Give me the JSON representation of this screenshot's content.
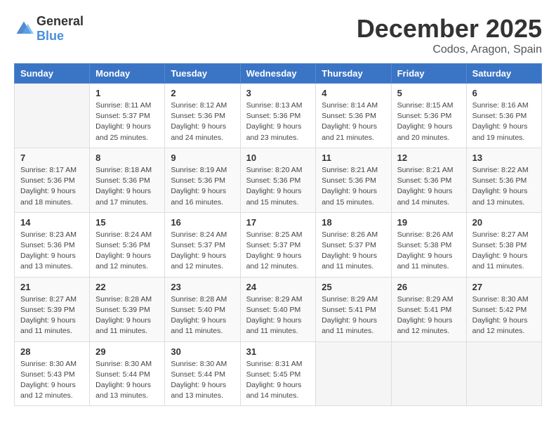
{
  "logo": {
    "general": "General",
    "blue": "Blue"
  },
  "header": {
    "month": "December 2025",
    "location": "Codos, Aragon, Spain"
  },
  "weekdays": [
    "Sunday",
    "Monday",
    "Tuesday",
    "Wednesday",
    "Thursday",
    "Friday",
    "Saturday"
  ],
  "weeks": [
    [
      {
        "day": "",
        "info": ""
      },
      {
        "day": "1",
        "info": "Sunrise: 8:11 AM\nSunset: 5:37 PM\nDaylight: 9 hours\nand 25 minutes."
      },
      {
        "day": "2",
        "info": "Sunrise: 8:12 AM\nSunset: 5:36 PM\nDaylight: 9 hours\nand 24 minutes."
      },
      {
        "day": "3",
        "info": "Sunrise: 8:13 AM\nSunset: 5:36 PM\nDaylight: 9 hours\nand 23 minutes."
      },
      {
        "day": "4",
        "info": "Sunrise: 8:14 AM\nSunset: 5:36 PM\nDaylight: 9 hours\nand 21 minutes."
      },
      {
        "day": "5",
        "info": "Sunrise: 8:15 AM\nSunset: 5:36 PM\nDaylight: 9 hours\nand 20 minutes."
      },
      {
        "day": "6",
        "info": "Sunrise: 8:16 AM\nSunset: 5:36 PM\nDaylight: 9 hours\nand 19 minutes."
      }
    ],
    [
      {
        "day": "7",
        "info": "Sunrise: 8:17 AM\nSunset: 5:36 PM\nDaylight: 9 hours\nand 18 minutes."
      },
      {
        "day": "8",
        "info": "Sunrise: 8:18 AM\nSunset: 5:36 PM\nDaylight: 9 hours\nand 17 minutes."
      },
      {
        "day": "9",
        "info": "Sunrise: 8:19 AM\nSunset: 5:36 PM\nDaylight: 9 hours\nand 16 minutes."
      },
      {
        "day": "10",
        "info": "Sunrise: 8:20 AM\nSunset: 5:36 PM\nDaylight: 9 hours\nand 15 minutes."
      },
      {
        "day": "11",
        "info": "Sunrise: 8:21 AM\nSunset: 5:36 PM\nDaylight: 9 hours\nand 15 minutes."
      },
      {
        "day": "12",
        "info": "Sunrise: 8:21 AM\nSunset: 5:36 PM\nDaylight: 9 hours\nand 14 minutes."
      },
      {
        "day": "13",
        "info": "Sunrise: 8:22 AM\nSunset: 5:36 PM\nDaylight: 9 hours\nand 13 minutes."
      }
    ],
    [
      {
        "day": "14",
        "info": "Sunrise: 8:23 AM\nSunset: 5:36 PM\nDaylight: 9 hours\nand 13 minutes."
      },
      {
        "day": "15",
        "info": "Sunrise: 8:24 AM\nSunset: 5:36 PM\nDaylight: 9 hours\nand 12 minutes."
      },
      {
        "day": "16",
        "info": "Sunrise: 8:24 AM\nSunset: 5:37 PM\nDaylight: 9 hours\nand 12 minutes."
      },
      {
        "day": "17",
        "info": "Sunrise: 8:25 AM\nSunset: 5:37 PM\nDaylight: 9 hours\nand 12 minutes."
      },
      {
        "day": "18",
        "info": "Sunrise: 8:26 AM\nSunset: 5:37 PM\nDaylight: 9 hours\nand 11 minutes."
      },
      {
        "day": "19",
        "info": "Sunrise: 8:26 AM\nSunset: 5:38 PM\nDaylight: 9 hours\nand 11 minutes."
      },
      {
        "day": "20",
        "info": "Sunrise: 8:27 AM\nSunset: 5:38 PM\nDaylight: 9 hours\nand 11 minutes."
      }
    ],
    [
      {
        "day": "21",
        "info": "Sunrise: 8:27 AM\nSunset: 5:39 PM\nDaylight: 9 hours\nand 11 minutes."
      },
      {
        "day": "22",
        "info": "Sunrise: 8:28 AM\nSunset: 5:39 PM\nDaylight: 9 hours\nand 11 minutes."
      },
      {
        "day": "23",
        "info": "Sunrise: 8:28 AM\nSunset: 5:40 PM\nDaylight: 9 hours\nand 11 minutes."
      },
      {
        "day": "24",
        "info": "Sunrise: 8:29 AM\nSunset: 5:40 PM\nDaylight: 9 hours\nand 11 minutes."
      },
      {
        "day": "25",
        "info": "Sunrise: 8:29 AM\nSunset: 5:41 PM\nDaylight: 9 hours\nand 11 minutes."
      },
      {
        "day": "26",
        "info": "Sunrise: 8:29 AM\nSunset: 5:41 PM\nDaylight: 9 hours\nand 12 minutes."
      },
      {
        "day": "27",
        "info": "Sunrise: 8:30 AM\nSunset: 5:42 PM\nDaylight: 9 hours\nand 12 minutes."
      }
    ],
    [
      {
        "day": "28",
        "info": "Sunrise: 8:30 AM\nSunset: 5:43 PM\nDaylight: 9 hours\nand 12 minutes."
      },
      {
        "day": "29",
        "info": "Sunrise: 8:30 AM\nSunset: 5:44 PM\nDaylight: 9 hours\nand 13 minutes."
      },
      {
        "day": "30",
        "info": "Sunrise: 8:30 AM\nSunset: 5:44 PM\nDaylight: 9 hours\nand 13 minutes."
      },
      {
        "day": "31",
        "info": "Sunrise: 8:31 AM\nSunset: 5:45 PM\nDaylight: 9 hours\nand 14 minutes."
      },
      {
        "day": "",
        "info": ""
      },
      {
        "day": "",
        "info": ""
      },
      {
        "day": "",
        "info": ""
      }
    ]
  ]
}
